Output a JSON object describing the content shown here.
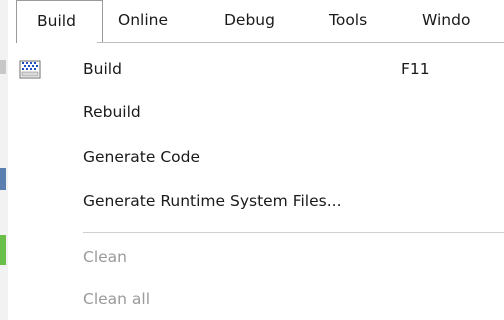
{
  "menubar": {
    "items": [
      {
        "label": "Build"
      },
      {
        "label": "Online"
      },
      {
        "label": "Debug"
      },
      {
        "label": "Tools"
      },
      {
        "label": "Windo"
      }
    ]
  },
  "build_menu": {
    "items": [
      {
        "label": "Build",
        "shortcut": "F11",
        "icon": "build-icon",
        "enabled": true
      },
      {
        "label": "Rebuild",
        "enabled": true
      },
      {
        "label": "Generate Code",
        "enabled": true
      },
      {
        "label": "Generate Runtime System Files...",
        "enabled": true
      },
      {
        "label": "Clean",
        "enabled": false
      },
      {
        "label": "Clean all",
        "enabled": false
      }
    ]
  },
  "colors": {
    "text": "#1a1a1a",
    "disabled_text": "#9a9a9a",
    "separator": "#cfcfcf",
    "icon_blue": "#1f4fc2",
    "edge_blue": "#5b7fb0",
    "edge_green": "#6abf4b"
  }
}
